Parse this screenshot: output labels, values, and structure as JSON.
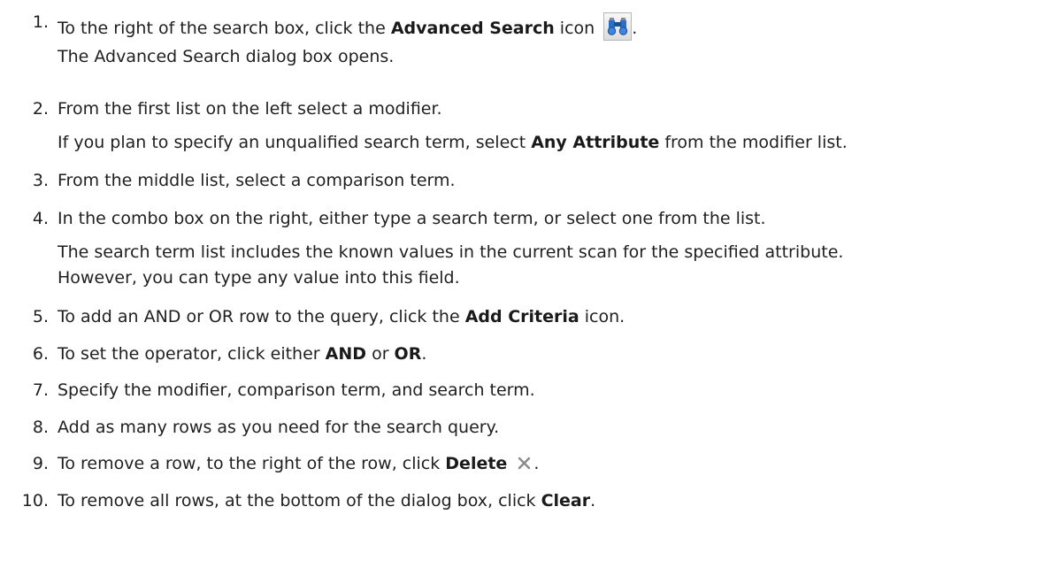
{
  "steps": [
    {
      "number": "1.",
      "parts": {
        "a": "To the right of the search box, click the ",
        "b": "Advanced Search",
        "c": " icon",
        "d": "."
      },
      "icon": "binoculars-icon",
      "note": "The Advanced Search dialog box opens."
    },
    {
      "number": "2.",
      "text": "From the first list on the left select a modifier.",
      "note_parts": {
        "a": "If you plan to specify an unqualified search term, select ",
        "b": "Any Attribute",
        "c": " from the modifier list."
      }
    },
    {
      "number": "3.",
      "text": "From the middle list, select a comparison term."
    },
    {
      "number": "4.",
      "text": "In the combo box on the right, either type a search term, or select one from the list.",
      "note_line1": "The search term list includes the known values in the current scan for the specified attribute.",
      "note_line2": "However, you can type any value into this field."
    },
    {
      "number": "5.",
      "parts": {
        "a": "To add an AND or OR row to the query, click the ",
        "b": "Add Criteria",
        "c": " icon."
      }
    },
    {
      "number": "6.",
      "parts": {
        "a": "To set the operator, click either ",
        "b": "AND",
        "c": " or ",
        "d": "OR",
        "e": "."
      }
    },
    {
      "number": "7.",
      "text": "Specify the modifier, comparison term, and search term."
    },
    {
      "number": "8.",
      "text": "Add as many rows as you need for the search query."
    },
    {
      "number": "9.",
      "parts": {
        "a": "To remove a row, to the right of the row, click ",
        "b": "Delete",
        "c": "."
      },
      "icon": "delete-x-icon"
    },
    {
      "number": "10.",
      "parts": {
        "a": "To remove all rows, at the bottom of the dialog box, click ",
        "b": "Clear",
        "c": "."
      }
    }
  ],
  "colors": {
    "text": "#1f1f1f",
    "icon_blue": "#2a6fc9",
    "icon_gray": "#8a8a8a"
  }
}
